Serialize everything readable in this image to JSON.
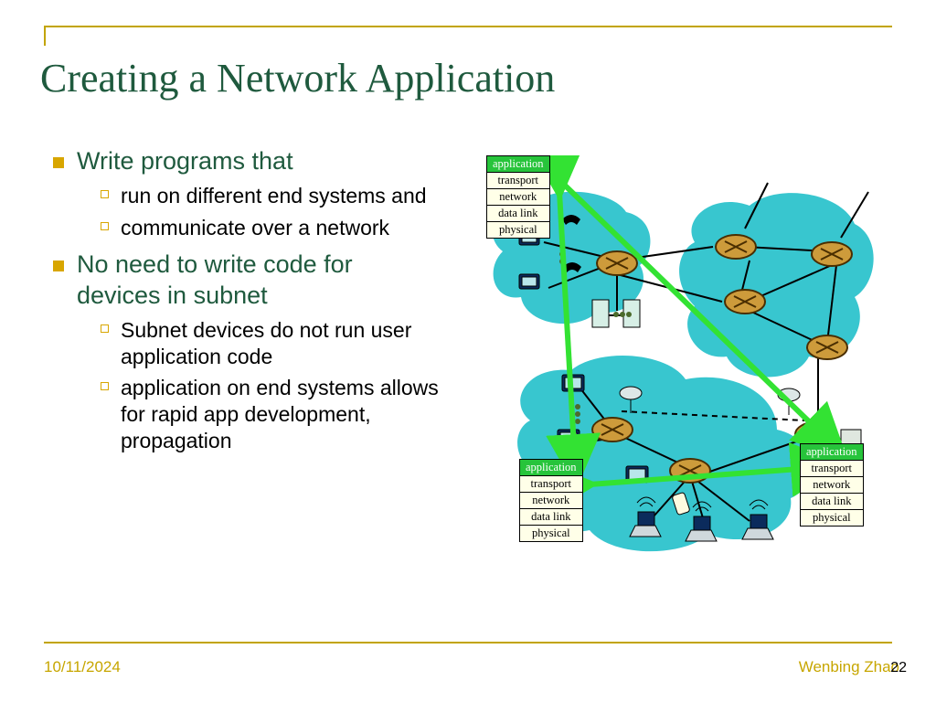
{
  "title": "Creating a Network Application",
  "bullets": {
    "l1_1": "Write programs that",
    "l1_1_subs": {
      "a": "run on different end systems and",
      "b": "communicate over a network"
    },
    "l1_2": "No need to write code for devices in subnet",
    "l1_2_subs": {
      "a": "Subnet devices do not run user application code",
      "b": "application on end systems allows for rapid app development, propagation"
    }
  },
  "stack_layers": {
    "application": "application",
    "transport": "transport",
    "network": "network",
    "data_link": "data link",
    "physical": "physical"
  },
  "footer": {
    "date": "10/11/2024",
    "author": "Wenbing Zhao",
    "page": "22"
  },
  "colors": {
    "accent_green": "#1f5a3e",
    "accent_gold": "#c2a400",
    "stack_app_bg": "#27c43b",
    "cloud": "#38c6cf",
    "router_fill": "#cd9b3b",
    "router_stroke": "#4a2e00",
    "arrow": "#33e233"
  }
}
